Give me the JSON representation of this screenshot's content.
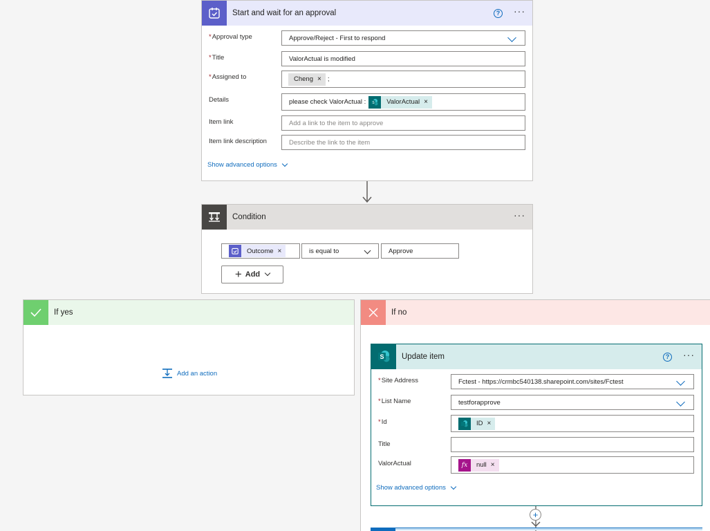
{
  "approval": {
    "title": "Start and wait for an approval",
    "help_icon": "?",
    "more_icon": "···",
    "fields": {
      "approval_type": {
        "label": "Approval type",
        "value": "Approve/Reject - First to respond"
      },
      "title": {
        "label": "Title",
        "value": "ValorActual is modified"
      },
      "assigned_to": {
        "label": "Assigned to",
        "token": "Cheng",
        "suffix": ";"
      },
      "details": {
        "label": "Details",
        "text": "please check ValorActual :",
        "token": "ValorActual"
      },
      "item_link": {
        "label": "Item link",
        "placeholder": "Add a link to the item to approve"
      },
      "item_link_description": {
        "label": "Item link description",
        "placeholder": "Describe the link to the item"
      }
    },
    "advanced": "Show advanced options",
    "required_mark": "*"
  },
  "condition": {
    "title": "Condition",
    "more_icon": "···",
    "left_token": "Outcome",
    "operator": "is equal to",
    "right_value": "Approve",
    "add_label": "Add"
  },
  "if_yes": {
    "title": "If yes",
    "add_action": "Add an action"
  },
  "if_no": {
    "title": "If no"
  },
  "update_item": {
    "title": "Update item",
    "help_icon": "?",
    "more_icon": "···",
    "fields": {
      "site_address": {
        "label": "Site Address",
        "value": "Fctest - https://crmbc540138.sharepoint.com/sites/Fctest"
      },
      "list_name": {
        "label": "List Name",
        "value": "testforapprove"
      },
      "id": {
        "label": "Id",
        "token": "ID"
      },
      "title": {
        "label": "Title",
        "value": ""
      },
      "valor_actual": {
        "label": "ValorActual",
        "token": "null"
      }
    },
    "advanced": "Show advanced options",
    "required_mark": "*"
  },
  "icons": {
    "token_close": "×",
    "plus": "+",
    "fx": "fx",
    "sharepoint": "S"
  },
  "colors": {
    "approval_accent": "#5c5fc9",
    "approval_header": "#e8e9fb",
    "condition_accent": "#484644",
    "condition_header": "#e1dfdd",
    "yes_accent": "#6fcf6f",
    "yes_header": "#eaf7ea",
    "no_accent": "#f28b82",
    "no_header": "#fde7e5",
    "sharepoint_accent": "#036c70",
    "sharepoint_header": "#d6ecec",
    "expression_accent": "#a5148b",
    "link": "#0f6cbd"
  }
}
